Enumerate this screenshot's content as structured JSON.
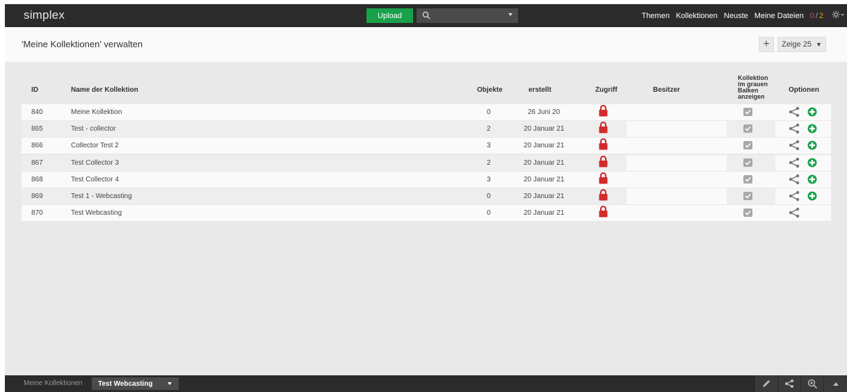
{
  "topbar": {
    "logo": "simplex",
    "upload_label": "Upload",
    "nav": {
      "themen": "Themen",
      "kollektionen": "Kollektionen",
      "neuste": "Neuste",
      "meine_dateien": "Meine Dateien",
      "count_a": "0",
      "sep": "/",
      "count_b": "2"
    }
  },
  "header": {
    "title": "'Meine Kollektionen' verwalten",
    "plus": "+",
    "zeige_label": "Zeige 25"
  },
  "table": {
    "columns": {
      "id": "ID",
      "name": "Name der Kollektion",
      "objekte": "Objekte",
      "erstellt": "erstellt",
      "zugriff": "Zugriff",
      "besitzer": "Besitzer",
      "grau_1": "Kollektion",
      "grau_2": "im grauen",
      "grau_3": "Balken",
      "grau_4": "anzeigen",
      "optionen": "Optionen"
    },
    "rows": [
      {
        "id": "840",
        "name": "Meine Kollektion",
        "objekte": "0",
        "erstellt": "26 Juni 20",
        "add": true
      },
      {
        "id": "865",
        "name": "Test - collector",
        "objekte": "2",
        "erstellt": "20 Januar 21",
        "add": true
      },
      {
        "id": "866",
        "name": "Collector Test 2",
        "objekte": "3",
        "erstellt": "20 Januar 21",
        "add": true
      },
      {
        "id": "867",
        "name": "Test Collector 3",
        "objekte": "2",
        "erstellt": "20 Januar 21",
        "add": true
      },
      {
        "id": "868",
        "name": "Test Collector 4",
        "objekte": "3",
        "erstellt": "20 Januar 21",
        "add": true
      },
      {
        "id": "869",
        "name": "Test 1 - Webcasting",
        "objekte": "0",
        "erstellt": "20 Januar 21",
        "add": true
      },
      {
        "id": "870",
        "name": "Test Webcasting",
        "objekte": "0",
        "erstellt": "20 Januar 21",
        "add": false
      }
    ]
  },
  "bottombar": {
    "label": "Meine Kollektionen",
    "selected": "Test Webcasting"
  },
  "colors": {
    "accent_green": "#19a14a",
    "lock_red": "#d22b2b",
    "bar": "#2b2b2b"
  }
}
